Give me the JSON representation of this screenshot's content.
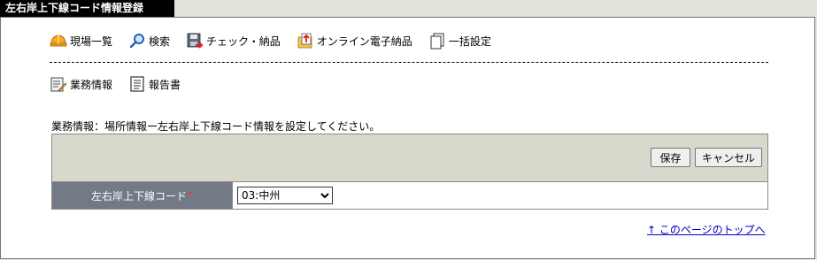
{
  "window": {
    "title": "左右岸上下線コード情報登録"
  },
  "toolbar_main": [
    {
      "label": "現場一覧",
      "icon": "hardhat-icon"
    },
    {
      "label": "検索",
      "icon": "search-icon"
    },
    {
      "label": "チェック・納品",
      "icon": "floppy-icon"
    },
    {
      "label": "オンライン電子納品",
      "icon": "folder-upload-icon"
    },
    {
      "label": "一括設定",
      "icon": "documents-icon"
    }
  ],
  "toolbar_sub": [
    {
      "label": "業務情報",
      "icon": "edit-document-icon"
    },
    {
      "label": "報告書",
      "icon": "report-icon"
    }
  ],
  "instruction": "業務情報：場所情報ー左右岸上下線コード情報を設定してください。",
  "form": {
    "save_label": "保存",
    "cancel_label": "キャンセル",
    "field_label": "左右岸上下線コード",
    "required_mark": "*",
    "selected_value": "03:中州"
  },
  "top_link": "↑ このページのトップへ",
  "colors": {
    "required": "#ff3a3a",
    "label_bg": "#737a86",
    "button_row_bg": "#d8d8cc",
    "link": "#0000cc"
  }
}
